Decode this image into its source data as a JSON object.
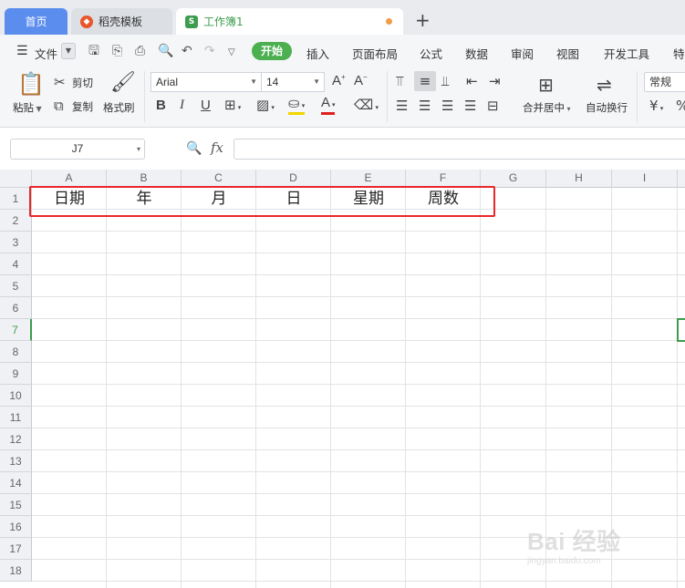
{
  "tabs": {
    "home": "首页",
    "template": "稻壳模板",
    "workbook": "工作簿1",
    "add": "+"
  },
  "menu": {
    "file": "文件",
    "items": [
      "开始",
      "插入",
      "页面布局",
      "公式",
      "数据",
      "审阅",
      "视图",
      "开发工具",
      "特"
    ]
  },
  "ribbon": {
    "paste": "粘贴",
    "cut": "剪切",
    "copy": "复制",
    "format_painter": "格式刷",
    "font_name": "Arial",
    "font_size": "14",
    "merge_center": "合并居中",
    "wrap_text": "自动换行",
    "number_format": "常规",
    "currency_symbol": "¥"
  },
  "formula_bar": {
    "name_box": "J7",
    "fx": "fx",
    "content": ""
  },
  "grid": {
    "columns": [
      "A",
      "B",
      "C",
      "D",
      "E",
      "F",
      "G",
      "H",
      "I"
    ],
    "rows": [
      "1",
      "2",
      "3",
      "4",
      "5",
      "6",
      "7",
      "8",
      "9",
      "10",
      "11",
      "12",
      "13",
      "14",
      "15",
      "16",
      "17",
      "18"
    ],
    "active_row": "7",
    "row1_cells": [
      "日期",
      "年",
      "月",
      "日",
      "星期",
      "周数"
    ]
  },
  "watermark": {
    "text": "Bai 经验",
    "url": "jingyan.baidu.com"
  },
  "colors": {
    "accent_green": "#4caf50",
    "highlight_red": "#e8272b",
    "home_tab_blue": "#5b8def"
  }
}
